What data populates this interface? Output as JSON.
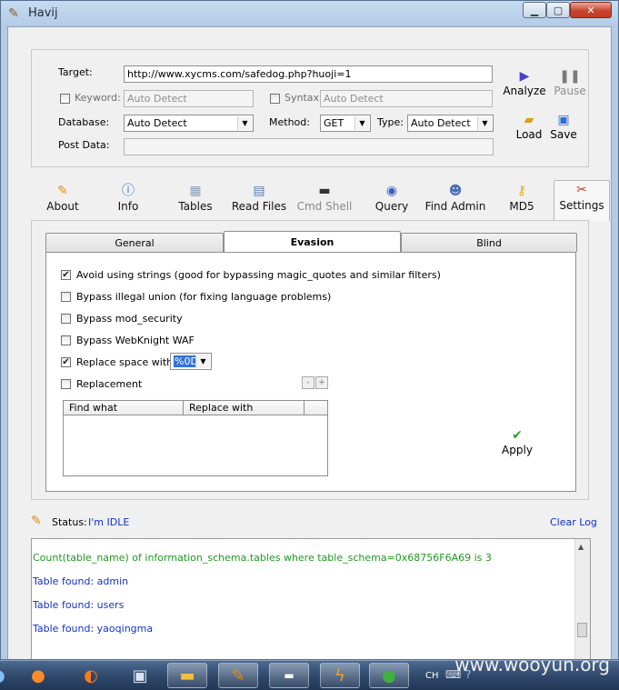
{
  "window": {
    "title": "Havij",
    "controls": {
      "minimize": "▁",
      "maximize": "▢",
      "close": "✕"
    }
  },
  "target_group": {
    "target_label": "Target:",
    "target_value": "http://www.xycms.com/safedog.php?huoji=1",
    "keyword_label": "Keyword:",
    "keyword_placeholder": "Auto Detect",
    "keyword_checked": false,
    "syntax_label": "Syntax:",
    "syntax_placeholder": "Auto Detect",
    "syntax_checked": false,
    "database_label": "Database:",
    "database_value": "Auto Detect",
    "method_label": "Method:",
    "method_value": "GET",
    "type_label": "Type:",
    "type_value": "Auto Detect",
    "post_data_label": "Post Data:",
    "post_data_value": ""
  },
  "toolbar": {
    "analyze": "Analyze",
    "pause": "Pause",
    "load": "Load",
    "save": "Save"
  },
  "tool_tabs": [
    {
      "label": "About",
      "icon": "carrot-icon",
      "enabled": true
    },
    {
      "label": "Info",
      "icon": "info-icon",
      "enabled": true
    },
    {
      "label": "Tables",
      "icon": "table-icon",
      "enabled": true
    },
    {
      "label": "Read Files",
      "icon": "file-icon",
      "enabled": true
    },
    {
      "label": "Cmd Shell",
      "icon": "terminal-icon",
      "enabled": false
    },
    {
      "label": "Query",
      "icon": "query-icon",
      "enabled": true
    },
    {
      "label": "Find Admin",
      "icon": "users-icon",
      "enabled": true
    },
    {
      "label": "MD5",
      "icon": "key-icon",
      "enabled": true
    },
    {
      "label": "Settings",
      "icon": "tools-icon",
      "enabled": true,
      "selected": true
    }
  ],
  "settings": {
    "subtabs": [
      "General",
      "Evasion",
      "Blind"
    ],
    "active_subtab": "Evasion",
    "options": [
      {
        "label": "Avoid using strings (good for bypassing magic_quotes and similar filters)",
        "checked": true
      },
      {
        "label": "Bypass illegal union (for fixing language problems)",
        "checked": false
      },
      {
        "label": "Bypass mod_security",
        "checked": false
      },
      {
        "label": "Bypass WebKnight WAF",
        "checked": false
      },
      {
        "label": "Replace space with:",
        "checked": true
      },
      {
        "label": "Replacement",
        "checked": false
      }
    ],
    "replace_space_value": "%0D",
    "replacement_columns": [
      "Find what",
      "Replace with"
    ],
    "minus_label": "-",
    "plus_label": "+",
    "apply_label": "Apply"
  },
  "status": {
    "label": "Status:",
    "value": "I'm IDLE",
    "clear_log": "Clear Log"
  },
  "log": [
    {
      "text": "Count(table_name) of information_schema.tables where table_schema=0x68756F6A69 is 3",
      "color": "#1f9a1f"
    },
    {
      "text": "Table found: admin",
      "color": "#1230d0"
    },
    {
      "text": "Table found: users",
      "color": "#1230d0"
    },
    {
      "text": "Table found: yaoqingma",
      "color": "#1230d0"
    }
  ],
  "taskbar": {
    "tray_lang": "CH",
    "watermark": "www.wooyun.org"
  }
}
